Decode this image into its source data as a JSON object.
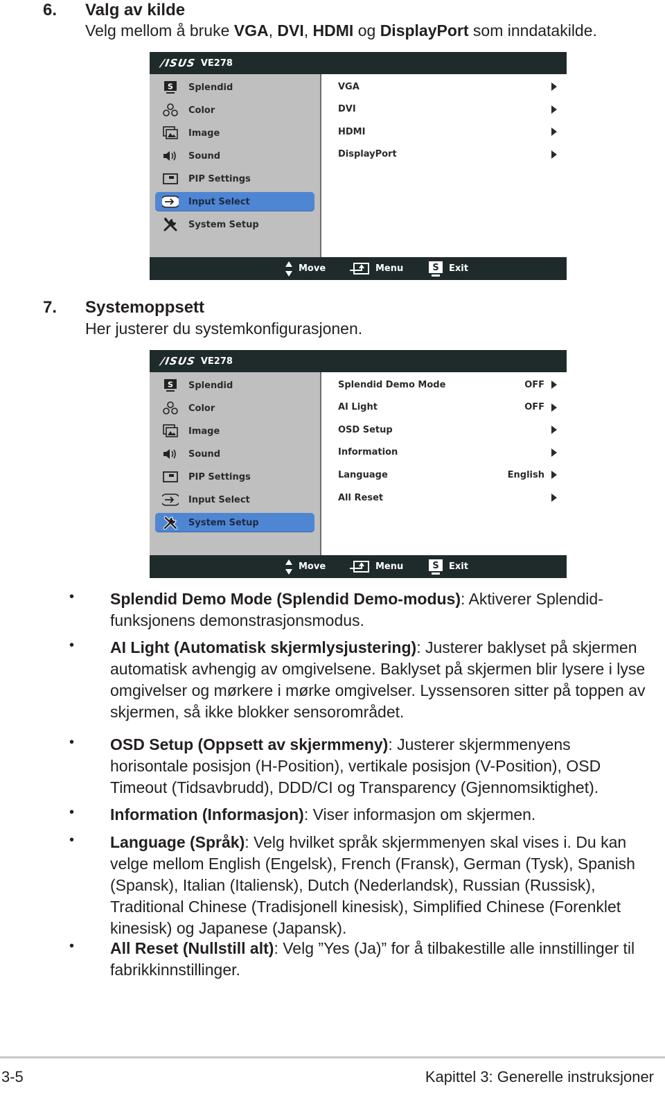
{
  "section6": {
    "number": "6.",
    "title": "Valg av kilde",
    "subtitle_parts": [
      "Velg mellom å bruke ",
      "VGA",
      ", ",
      "DVI",
      ", ",
      "HDMI",
      " og ",
      "DisplayPort",
      " som inndatakilde."
    ]
  },
  "osd1": {
    "brand": "/ISUS",
    "model": "VE278",
    "menu": [
      {
        "label": "Splendid",
        "icon": "splendid-icon"
      },
      {
        "label": "Color",
        "icon": "color-icon"
      },
      {
        "label": "Image",
        "icon": "image-icon"
      },
      {
        "label": "Sound",
        "icon": "sound-icon"
      },
      {
        "label": "PIP Settings",
        "icon": "pip-icon"
      },
      {
        "label": "Input Select",
        "icon": "input-select-icon",
        "active": true
      },
      {
        "label": "System Setup",
        "icon": "system-setup-icon"
      }
    ],
    "options": [
      {
        "label": "VGA",
        "value": ""
      },
      {
        "label": "DVI",
        "value": ""
      },
      {
        "label": "HDMI",
        "value": ""
      },
      {
        "label": "DisplayPort",
        "value": ""
      }
    ],
    "nav": {
      "move": "Move",
      "menu": "Menu",
      "exit": "Exit",
      "exit_key": "S"
    }
  },
  "section7": {
    "number": "7.",
    "title": "Systemoppsett",
    "subtitle": "Her justerer du systemkonfigurasjonen."
  },
  "osd2": {
    "brand": "/ISUS",
    "model": "VE278",
    "menu": [
      {
        "label": "Splendid",
        "icon": "splendid-icon"
      },
      {
        "label": "Color",
        "icon": "color-icon"
      },
      {
        "label": "Image",
        "icon": "image-icon"
      },
      {
        "label": "Sound",
        "icon": "sound-icon"
      },
      {
        "label": "PIP Settings",
        "icon": "pip-icon"
      },
      {
        "label": "Input Select",
        "icon": "input-select-icon"
      },
      {
        "label": "System Setup",
        "icon": "system-setup-icon",
        "active": true
      }
    ],
    "options": [
      {
        "label": "Splendid Demo Mode",
        "value": "OFF"
      },
      {
        "label": "AI Light",
        "value": "OFF"
      },
      {
        "label": "OSD Setup",
        "value": ""
      },
      {
        "label": "Information",
        "value": ""
      },
      {
        "label": "Language",
        "value": "English"
      },
      {
        "label": "All Reset",
        "value": ""
      }
    ],
    "nav": {
      "move": "Move",
      "menu": "Menu",
      "exit": "Exit",
      "exit_key": "S"
    }
  },
  "bullets": [
    {
      "bold": "Splendid Demo Mode (Splendid Demo-modus)",
      "text": ": Aktiverer Splendid-funksjonens demonstrasjonsmodus."
    },
    {
      "bold": "AI Light (Automatisk skjermlysjustering)",
      "text": ": Justerer baklyset på skjermen automatisk avhengig av omgivelsene. Baklyset på skjermen blir lysere i lyse omgivelser og mørkere i mørke omgivelser. Lyssensoren sitter på toppen av skjermen, så ikke blokker sensorområdet."
    },
    {
      "bold": "OSD Setup (Oppsett av skjermmeny)",
      "text": ": Justerer skjermmenyens horisontale posisjon (H-Position), vertikale posisjon (V-Position), OSD Timeout (Tidsavbrudd), DDD/CI og Transparency (Gjennomsiktighet)."
    },
    {
      "bold": "Information (Informasjon)",
      "text": ": Viser informasjon om skjermen."
    },
    {
      "bold": "Language (Språk)",
      "text": ": Velg hvilket språk skjermmenyen skal vises i. Du kan velge mellom English (Engelsk), French (Fransk), German (Tysk), Spanish (Spansk), Italian (Italiensk), Dutch (Nederlandsk), Russian (Russisk), Traditional Chinese (Tradisjonell kinesisk), Simplified Chinese (Forenklet kinesisk) og Japanese (Japansk)."
    },
    {
      "bold": "All Reset (Nullstill alt)",
      "text": ": Velg ”Yes (Ja)” for å tilbakestille alle innstillinger til fabrikkinnstillinger."
    }
  ],
  "bullet_symbol": "•",
  "footer": {
    "page": "3-5",
    "chapter": "Kapittel 3: Generelle instruksjoner"
  },
  "colors": {
    "osd_dark": "#1f2a2a",
    "osd_grey": "#bfbfbf",
    "highlight": "#4f86d4"
  }
}
